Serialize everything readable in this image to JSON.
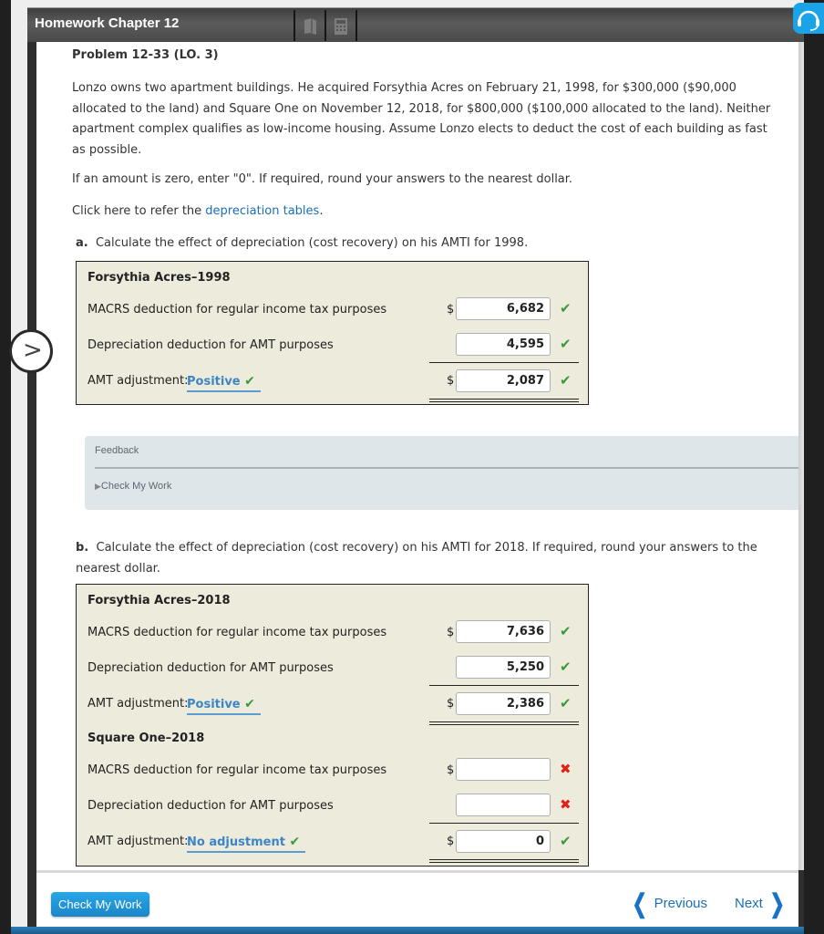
{
  "window": {
    "title": "Homework Chapter 12",
    "toolbar_icons": [
      "book-icon",
      "calculator-icon"
    ],
    "help_icon": "headset-icon"
  },
  "problem": {
    "title": "Problem 12-33 (LO. 3)",
    "description": "Lonzo owns two apartment buildings. He acquired Forsythia Acres on February 21, 1998, for $300,000 ($90,000 allocated to the land) and Square One on November 12, 2018, for $800,000 ($100,000 allocated to the land). Neither apartment complex qualifies as low-income housing. Assume Lonzo elects to deduct the cost of each building as fast as possible.",
    "instructions": "If an amount is zero, enter \"0\". If required, round your answers to the nearest dollar.",
    "reference_prefix": "Click here to refer the ",
    "reference_link": "depreciation tables",
    "reference_suffix": "."
  },
  "part_a": {
    "label": "a.",
    "question": "Calculate the effect of depreciation (cost recovery) on his AMTI for 1998.",
    "section": {
      "heading": "Forsythia Acres–1998",
      "rows": [
        {
          "label": "MACRS deduction for regular income tax purposes",
          "currency": "$",
          "value": "6,682",
          "status": "correct"
        },
        {
          "label": "Depreciation deduction for AMT purposes",
          "currency": "",
          "value": "4,595",
          "status": "correct"
        },
        {
          "label": "AMT adjustment:",
          "select_value": "Positive",
          "select_status": "correct",
          "currency": "$",
          "value": "2,087",
          "status": "correct"
        }
      ]
    }
  },
  "feedback": {
    "title": "Feedback",
    "toggle_label": "Check My Work"
  },
  "part_b": {
    "label": "b.",
    "question": "Calculate the effect of depreciation (cost recovery) on his AMTI for 2018. If required, round your answers to the nearest dollar.",
    "sections": [
      {
        "heading": "Forsythia Acres–2018",
        "rows": [
          {
            "label": "MACRS deduction for regular income tax purposes",
            "currency": "$",
            "value": "7,636",
            "status": "correct"
          },
          {
            "label": "Depreciation deduction for AMT purposes",
            "currency": "",
            "value": "5,250",
            "status": "correct"
          },
          {
            "label": "AMT adjustment:",
            "select_value": "Positive",
            "select_status": "correct",
            "currency": "$",
            "value": "2,386",
            "status": "correct"
          }
        ]
      },
      {
        "heading": "Square One–2018",
        "rows": [
          {
            "label": "MACRS deduction for regular income tax purposes",
            "currency": "$",
            "value": "",
            "status": "incorrect"
          },
          {
            "label": "Depreciation deduction for AMT purposes",
            "currency": "",
            "value": "",
            "status": "incorrect"
          },
          {
            "label": "AMT adjustment:",
            "select_value": "No adjustment",
            "select_status": "correct",
            "currency": "$",
            "value": "0",
            "status": "correct"
          }
        ]
      }
    ]
  },
  "marks": {
    "correct": "✔",
    "incorrect": "✖"
  },
  "footer": {
    "check_button": "Check My Work",
    "previous": "Previous",
    "next": "Next"
  },
  "colors": {
    "accent": "#1a86c8",
    "correct": "#3a9a3a",
    "incorrect": "#e0201a",
    "link": "#1a6fb5"
  }
}
